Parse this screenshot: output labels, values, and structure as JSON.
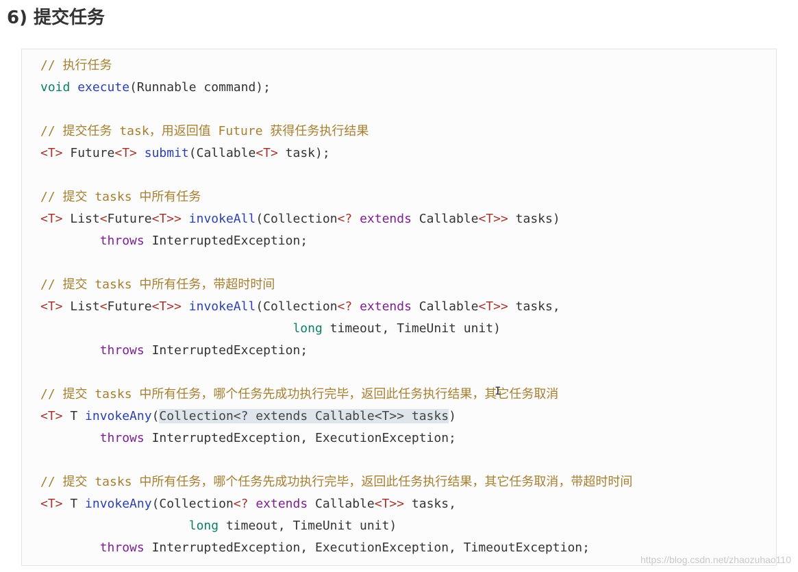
{
  "heading": "6) 提交任务",
  "watermark": "https://blog.csdn.net/zhaozuhao110",
  "cursor_glyph": "I",
  "code_lines": [
    [
      {
        "t": "// 执行任务",
        "c": "comment"
      }
    ],
    [
      {
        "t": "void",
        "c": "type"
      },
      {
        "t": " "
      },
      {
        "t": "execute",
        "c": "fn"
      },
      {
        "t": "(Runnable command);"
      }
    ],
    [],
    [
      {
        "t": "// 提交任务 task，用返回值 Future 获得任务执行结果",
        "c": "comment"
      }
    ],
    [
      {
        "t": "<T>",
        "c": "gen"
      },
      {
        "t": " Future"
      },
      {
        "t": "<T>",
        "c": "gen"
      },
      {
        "t": " "
      },
      {
        "t": "submit",
        "c": "fn"
      },
      {
        "t": "(Callable"
      },
      {
        "t": "<T>",
        "c": "gen"
      },
      {
        "t": " task);"
      }
    ],
    [],
    [
      {
        "t": "// 提交 tasks 中所有任务",
        "c": "comment"
      }
    ],
    [
      {
        "t": "<T>",
        "c": "gen"
      },
      {
        "t": " List"
      },
      {
        "t": "<",
        "c": "gen"
      },
      {
        "t": "Future"
      },
      {
        "t": "<T>>",
        "c": "gen"
      },
      {
        "t": " "
      },
      {
        "t": "invokeAll",
        "c": "fn"
      },
      {
        "t": "(Collection"
      },
      {
        "t": "<? ",
        "c": "gen"
      },
      {
        "t": "extends",
        "c": "kw"
      },
      {
        "t": " Callable"
      },
      {
        "t": "<T>>",
        "c": "gen"
      },
      {
        "t": " tasks)"
      }
    ],
    [
      {
        "t": "        "
      },
      {
        "t": "throws",
        "c": "kw"
      },
      {
        "t": " InterruptedException;"
      }
    ],
    [],
    [
      {
        "t": "// 提交 tasks 中所有任务，带超时时间",
        "c": "comment"
      }
    ],
    [
      {
        "t": "<T>",
        "c": "gen"
      },
      {
        "t": " List"
      },
      {
        "t": "<",
        "c": "gen"
      },
      {
        "t": "Future"
      },
      {
        "t": "<T>>",
        "c": "gen"
      },
      {
        "t": " "
      },
      {
        "t": "invokeAll",
        "c": "fn"
      },
      {
        "t": "(Collection"
      },
      {
        "t": "<? ",
        "c": "gen"
      },
      {
        "t": "extends",
        "c": "kw"
      },
      {
        "t": " Callable"
      },
      {
        "t": "<T>>",
        "c": "gen"
      },
      {
        "t": " tasks,"
      }
    ],
    [
      {
        "t": "                                  "
      },
      {
        "t": "long",
        "c": "type"
      },
      {
        "t": " timeout, TimeUnit unit)"
      }
    ],
    [
      {
        "t": "        "
      },
      {
        "t": "throws",
        "c": "kw"
      },
      {
        "t": " InterruptedException;"
      }
    ],
    [],
    [
      {
        "t": "// 提交 tasks 中所有任务，哪个任务先成功执行完毕，返回此任务执行结果，其它任务取消",
        "c": "comment"
      }
    ],
    [
      {
        "t": "<T>",
        "c": "gen"
      },
      {
        "t": " T "
      },
      {
        "t": "invokeAny",
        "c": "fn"
      },
      {
        "t": "("
      },
      {
        "t": "Collection<? extends Callable<T>> tasks",
        "c": "hl"
      },
      {
        "t": ")"
      }
    ],
    [
      {
        "t": "        "
      },
      {
        "t": "throws",
        "c": "kw"
      },
      {
        "t": " InterruptedException, ExecutionException;"
      }
    ],
    [],
    [
      {
        "t": "// 提交 tasks 中所有任务，哪个任务先成功执行完毕，返回此任务执行结果，其它任务取消，带超时时间",
        "c": "comment"
      }
    ],
    [
      {
        "t": "<T>",
        "c": "gen"
      },
      {
        "t": " T "
      },
      {
        "t": "invokeAny",
        "c": "fn"
      },
      {
        "t": "(Collection"
      },
      {
        "t": "<? ",
        "c": "gen"
      },
      {
        "t": "extends",
        "c": "kw"
      },
      {
        "t": " Callable"
      },
      {
        "t": "<T>>",
        "c": "gen"
      },
      {
        "t": " tasks,"
      }
    ],
    [
      {
        "t": "                    "
      },
      {
        "t": "long",
        "c": "type"
      },
      {
        "t": " timeout, TimeUnit unit)"
      }
    ],
    [
      {
        "t": "        "
      },
      {
        "t": "throws",
        "c": "kw"
      },
      {
        "t": " InterruptedException, ExecutionException, TimeoutException;"
      }
    ]
  ]
}
